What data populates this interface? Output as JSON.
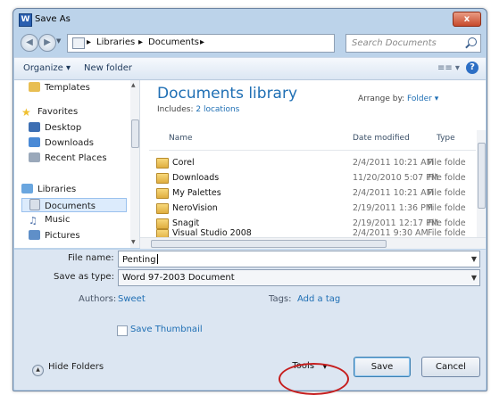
{
  "window": {
    "title": "Save As",
    "close_label": "x",
    "app_icon_letter": "W"
  },
  "address": {
    "crumbs": [
      "Libraries",
      "Documents"
    ],
    "search_placeholder": "Search Documents"
  },
  "toolbar": {
    "organize_label": "Organize ▾",
    "new_folder_label": "New folder",
    "views_label": "≡≡ ▾",
    "help_label": "?"
  },
  "nav": {
    "items": [
      {
        "label": "Templates",
        "icon": "folder-icon",
        "color": "#e8be52"
      },
      {
        "label": "Favorites",
        "icon": "star-icon",
        "color": "#f0c030"
      },
      {
        "label": "Desktop",
        "icon": "desktop-icon",
        "color": "#3d6fb3"
      },
      {
        "label": "Downloads",
        "icon": "downloads-icon",
        "color": "#4a8ad6"
      },
      {
        "label": "Recent Places",
        "icon": "recent-places-icon",
        "color": "#9aa8ba"
      },
      {
        "label": "Libraries",
        "icon": "libraries-icon",
        "color": "#6aa6df"
      },
      {
        "label": "Documents",
        "icon": "documents-icon",
        "color": "#d8dfe9"
      },
      {
        "label": "Music",
        "icon": "music-icon",
        "color": "#4a6fa8"
      },
      {
        "label": "Pictures",
        "icon": "pictures-icon",
        "color": "#5f8fc8"
      }
    ]
  },
  "library": {
    "title": "Documents library",
    "includes_label": "Includes:",
    "includes_link": "2 locations",
    "arrange_label": "Arrange by:",
    "arrange_value": "Folder ▾"
  },
  "columns": {
    "name": "Name",
    "date": "Date modified",
    "type": "Type"
  },
  "files": [
    {
      "name": "Corel",
      "date": "2/4/2011 10:21 AM",
      "type": "File folde"
    },
    {
      "name": "Downloads",
      "date": "11/20/2010 5:07 PM",
      "type": "File folde"
    },
    {
      "name": "My Palettes",
      "date": "2/4/2011 10:21 AM",
      "type": "File folde"
    },
    {
      "name": "NeroVision",
      "date": "2/19/2011 1:36 PM",
      "type": "File folde"
    },
    {
      "name": "Snagit",
      "date": "2/19/2011 12:17 PM",
      "type": "File folde"
    },
    {
      "name": "Visual Studio 2008",
      "date": "2/4/2011 9:30 AM",
      "type": "File folde"
    }
  ],
  "form": {
    "file_name_label": "File name:",
    "file_name_value": "Penting",
    "save_type_label": "Save as type:",
    "save_type_value": "Word 97-2003 Document",
    "authors_label": "Authors:",
    "authors_value": "Sweet",
    "tags_label": "Tags:",
    "tags_value": "Add a tag",
    "thumbnail_label": "Save Thumbnail"
  },
  "footer": {
    "hide_folders_label": "Hide Folders",
    "tools_label": "Tools",
    "save_label": "Save",
    "cancel_label": "Cancel"
  },
  "colors": {
    "highlight_oval": "#c61e1e",
    "link": "#1f6fb4"
  }
}
